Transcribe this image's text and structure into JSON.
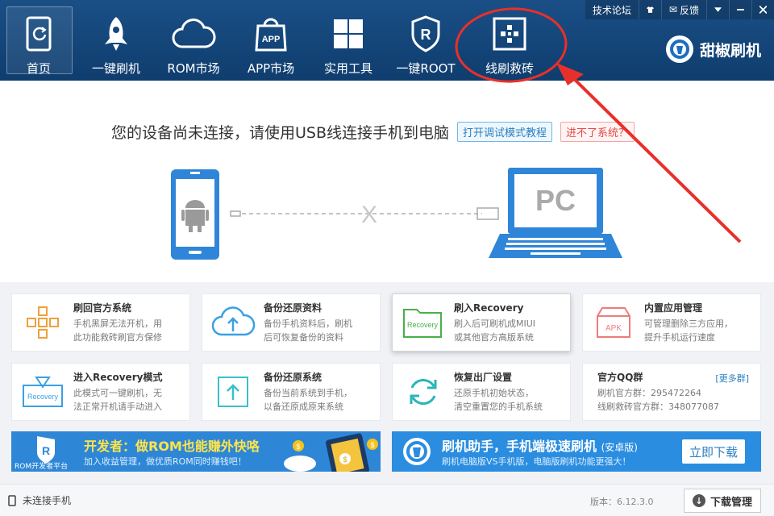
{
  "header": {
    "topbar": {
      "forum": "技术论坛",
      "shirt_icon": "shirt-icon",
      "feedback": "反馈",
      "menu_icon": "menu-dropdown-icon",
      "minimize_icon": "minimize-icon",
      "close_icon": "close-icon"
    },
    "nav": [
      {
        "label": "首页",
        "icon": "home-phone-icon"
      },
      {
        "label": "一键刷机",
        "icon": "rocket-icon"
      },
      {
        "label": "ROM市场",
        "icon": "cloud-icon"
      },
      {
        "label": "APP市场",
        "icon": "app-bag-icon"
      },
      {
        "label": "实用工具",
        "icon": "grid-tools-icon"
      },
      {
        "label": "一键ROOT",
        "icon": "root-shield-icon"
      },
      {
        "label": "线刷救砖",
        "icon": "flash-rescue-icon"
      }
    ],
    "brand": "甜椒刷机",
    "brand_icon": "tianjiao-logo-icon"
  },
  "main": {
    "status_message": "您的设备尚未连接，请使用USB线连接手机到电脑",
    "debug_tutorial": "打开调试模式教程",
    "cannot_enter": "进不了系统？",
    "pc_label": "PC"
  },
  "cards": [
    {
      "title": "刷回官方系统",
      "desc1": "手机黑屏无法开机，用",
      "desc2": "此功能救砖刷官方保修"
    },
    {
      "title": "备份还原资料",
      "desc1": "备份手机资料后，刷机",
      "desc2": "后可恢复备份的资料"
    },
    {
      "title": "刷入Recovery",
      "desc1": "刷入后可刷机成MIUI",
      "desc2": "或其他官方高版系统",
      "icon_text": "Recovery"
    },
    {
      "title": "内置应用管理",
      "desc1": "可管理删除三方应用，",
      "desc2": "提升手机运行速度",
      "icon_text": "APK"
    },
    {
      "title": "进入Recovery模式",
      "desc1": "此模式可一键刷机，无",
      "desc2": "法正常开机请手动进入",
      "icon_text": "Recovery"
    },
    {
      "title": "备份还原系统",
      "desc1": "备份当前系统到手机，",
      "desc2": "以备还原成原来系统"
    },
    {
      "title": "恢复出厂设置",
      "desc1": "还原手机初始状态，",
      "desc2": "清空重置您的手机系统"
    },
    {
      "title": "官方QQ群",
      "desc1": "刷机官方群：295472264",
      "desc2": "线刷救砖官方群：348077087",
      "more": "[更多群]"
    }
  ],
  "banners": {
    "left": {
      "title": "开发者：做ROM也能赚外快咯",
      "sub": "加入收益管理，做优质ROM同时赚钱吧！",
      "badge": "ROM开发者平台"
    },
    "right": {
      "title": "刷机助手，手机端极速刷机",
      "title_suffix": "(安卓版)",
      "sub": "刷机电脑版VS手机版，电脑版刷机功能更强大！",
      "button": "立即下载"
    }
  },
  "footer": {
    "connection": "未连接手机",
    "version": "版本：6.12.3.0",
    "download_manager": "下载管理"
  }
}
